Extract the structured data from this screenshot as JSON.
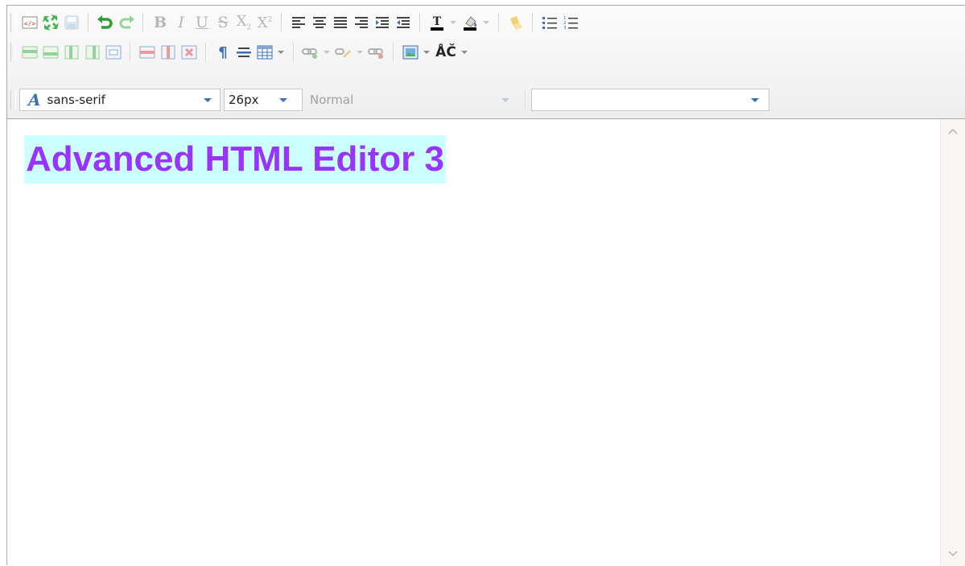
{
  "toolbar": {
    "row1": {
      "buttons": [
        {
          "name": "html-source-icon"
        },
        {
          "name": "fullscreen-icon"
        },
        {
          "name": "save-icon"
        },
        {
          "name": "undo-icon"
        },
        {
          "name": "redo-icon"
        },
        {
          "name": "bold-button",
          "glyph": "B"
        },
        {
          "name": "italic-button",
          "glyph": "I"
        },
        {
          "name": "underline-button",
          "glyph": "U"
        },
        {
          "name": "strikethrough-button",
          "glyph": "S"
        },
        {
          "name": "subscript-button",
          "glyph": "X",
          "mark": "2"
        },
        {
          "name": "superscript-button",
          "glyph": "X",
          "mark": "2"
        },
        {
          "name": "align-left-icon"
        },
        {
          "name": "align-center-icon"
        },
        {
          "name": "align-justify-icon"
        },
        {
          "name": "align-right-icon"
        },
        {
          "name": "indent-icon"
        },
        {
          "name": "outdent-icon"
        },
        {
          "name": "text-color-icon",
          "glyph": "T",
          "swatch": "#000000"
        },
        {
          "name": "highlight-color-icon",
          "swatch": "#000000"
        },
        {
          "name": "clear-format-icon"
        },
        {
          "name": "bullet-list-icon"
        },
        {
          "name": "numbered-list-icon"
        }
      ]
    },
    "row2": {
      "buttons": [
        {
          "name": "insert-row-above-icon"
        },
        {
          "name": "insert-row-below-icon"
        },
        {
          "name": "insert-column-left-icon"
        },
        {
          "name": "insert-column-right-icon"
        },
        {
          "name": "merge-cells-icon"
        },
        {
          "name": "delete-row-icon"
        },
        {
          "name": "delete-column-icon"
        },
        {
          "name": "delete-table-icon"
        },
        {
          "name": "paragraph-mark-icon",
          "glyph": "¶"
        },
        {
          "name": "horizontal-rule-icon"
        },
        {
          "name": "insert-table-icon"
        },
        {
          "name": "insert-link-icon"
        },
        {
          "name": "edit-link-icon"
        },
        {
          "name": "remove-link-icon"
        },
        {
          "name": "insert-image-icon"
        },
        {
          "name": "special-characters-icon",
          "glyph": "ÅČ"
        }
      ]
    },
    "row3": {
      "font_family": {
        "value": "sans-serif",
        "icon": "font-icon",
        "icon_glyph": "A"
      },
      "font_size": {
        "value": "26px"
      },
      "paragraph_format": {
        "value": "Normal"
      },
      "style_select": {
        "value": ""
      }
    }
  },
  "document": {
    "heading": "Advanced HTML Editor 3",
    "heading_color": "#9933ff",
    "heading_background": "#ccffff"
  },
  "scrollbar": {
    "up_icon": "chevron-up-icon",
    "down_icon": "chevron-down-icon"
  },
  "colors": {
    "accent_green": "#45b74a",
    "accent_blue": "#3b6fb6",
    "border": "#a9a9a9"
  }
}
